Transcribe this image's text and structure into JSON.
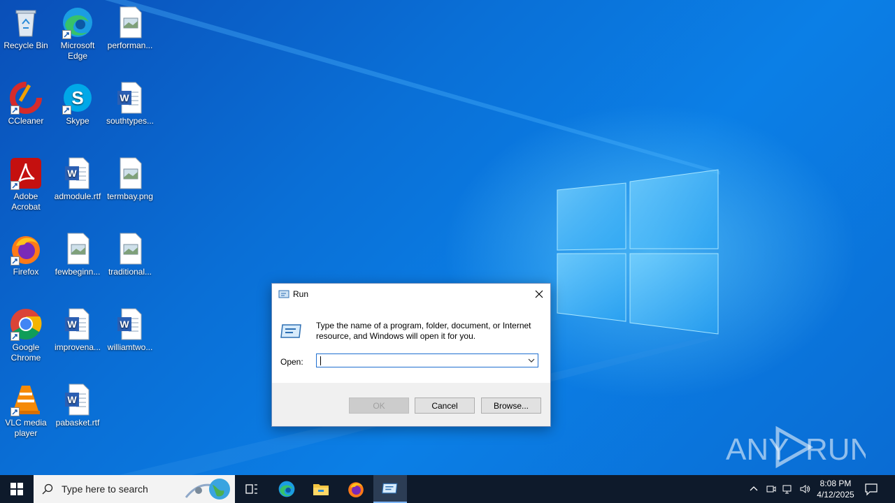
{
  "desktop": {
    "icons": [
      {
        "label": "Recycle Bin",
        "icon": "recycle-bin-icon"
      },
      {
        "label": "Microsoft Edge",
        "icon": "edge-icon"
      },
      {
        "label": "performan...",
        "icon": "image-file-icon"
      },
      {
        "label": "CCleaner",
        "icon": "ccleaner-icon"
      },
      {
        "label": "Skype",
        "icon": "skype-icon"
      },
      {
        "label": "southtypes...",
        "icon": "word-file-icon"
      },
      {
        "label": "Adobe Acrobat",
        "icon": "acrobat-icon"
      },
      {
        "label": "admodule.rtf",
        "icon": "word-file-icon"
      },
      {
        "label": "termbay.png",
        "icon": "image-file-icon"
      },
      {
        "label": "Firefox",
        "icon": "firefox-icon"
      },
      {
        "label": "fewbeginn...",
        "icon": "image-file-icon"
      },
      {
        "label": "traditional...",
        "icon": "image-file-icon"
      },
      {
        "label": "Google Chrome",
        "icon": "chrome-icon"
      },
      {
        "label": "improvena...",
        "icon": "word-file-icon"
      },
      {
        "label": "williamtwo...",
        "icon": "word-file-icon"
      },
      {
        "label": "VLC media player",
        "icon": "vlc-icon"
      },
      {
        "label": "pabasket.rtf",
        "icon": "word-file-icon"
      }
    ]
  },
  "run_dialog": {
    "title": "Run",
    "description": "Type the name of a program, folder, document, or Internet resource, and Windows will open it for you.",
    "open_label": "Open:",
    "open_value": "",
    "ok_label": "OK",
    "cancel_label": "Cancel",
    "browse_label": "Browse..."
  },
  "watermark": {
    "text": "ANY RUN"
  },
  "taskbar": {
    "search_placeholder": "Type here to search",
    "apps": [
      "task-view-icon",
      "edge-icon",
      "file-explorer-icon",
      "firefox-icon",
      "run-icon"
    ],
    "clock_time": "8:08 PM",
    "clock_date": "4/12/2025"
  },
  "colors": {
    "wallpaper": "#0a6fd6",
    "taskbar": "#0e1a2b",
    "input_border": "#1f6fd0"
  }
}
